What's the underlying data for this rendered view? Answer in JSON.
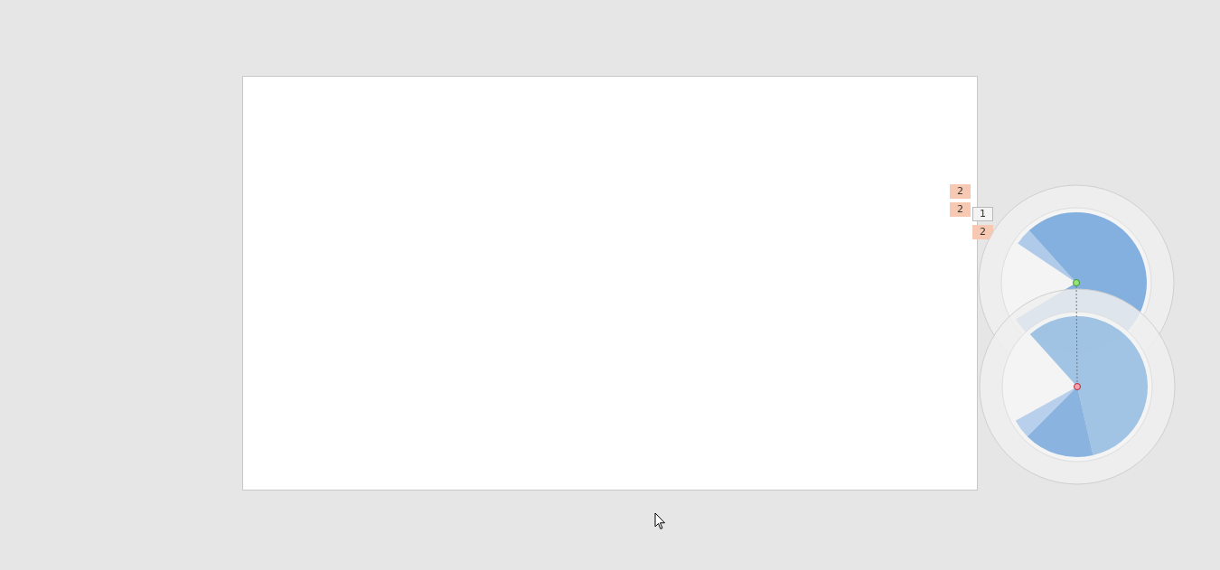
{
  "slide": {
    "kind": "blank"
  },
  "animation_tags": [
    {
      "label": "2",
      "selected": true
    },
    {
      "label": "2",
      "selected": true
    },
    {
      "label": "1",
      "selected": false
    },
    {
      "label": "2",
      "selected": true
    }
  ],
  "motion_path": {
    "kind": "spin"
  }
}
